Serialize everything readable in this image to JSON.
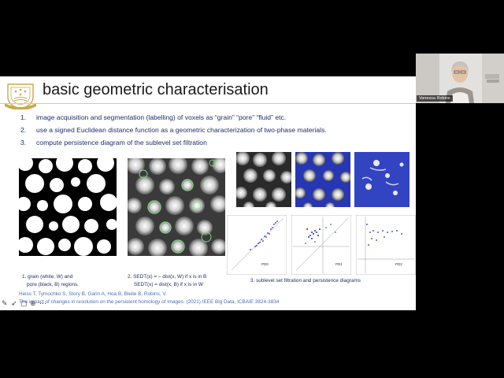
{
  "slide": {
    "title": "basic geometric characterisation",
    "items": [
      {
        "num": "1.",
        "text": "image acquisition and segmentation (labelling) of voxels as “grain” “pore” “fluid” etc."
      },
      {
        "num": "2.",
        "text": "use a signed Euclidean distance function as a geometric characterization of two-phase materials."
      },
      {
        "num": "3.",
        "text": "compute persistence diagram of the sublevel set filtration"
      }
    ],
    "captions": {
      "c1_line1": "1. grain (white, W) and",
      "c1_line2": "pore (black, B) regions.",
      "c2_line1": "2. SEDT(x) = – dist(x, W)   if x is in B",
      "c2_line2": "SEDT(x) =  dist(x, B)      if x is in W",
      "c3": "3.  sublevel set filtration and persistence diagrams"
    },
    "diagram_labels": [
      "PD0",
      "PD1",
      "PD2"
    ],
    "reference_line1": "Heiss T, Tymochko S, Story B, Garin A, Hoa B, Bleile B, Robins, V.",
    "reference_line2": "The impact of changes in resolution on the persistent homology of images. (2021) IEEE Big Data, ICBAIE 3824-3834"
  },
  "participant": {
    "name": "Vanessa Robins"
  },
  "colors": {
    "title_text": "#1a1a1a",
    "body_text": "#1f2d6b",
    "reference_text": "#4b6fb2",
    "filtration_blue": "#2636b4",
    "logo_gold": "#c9a94b"
  },
  "icons": [
    "pen-icon",
    "pointer-icon",
    "slides-icon",
    "zoom-icon",
    "more-icon"
  ]
}
